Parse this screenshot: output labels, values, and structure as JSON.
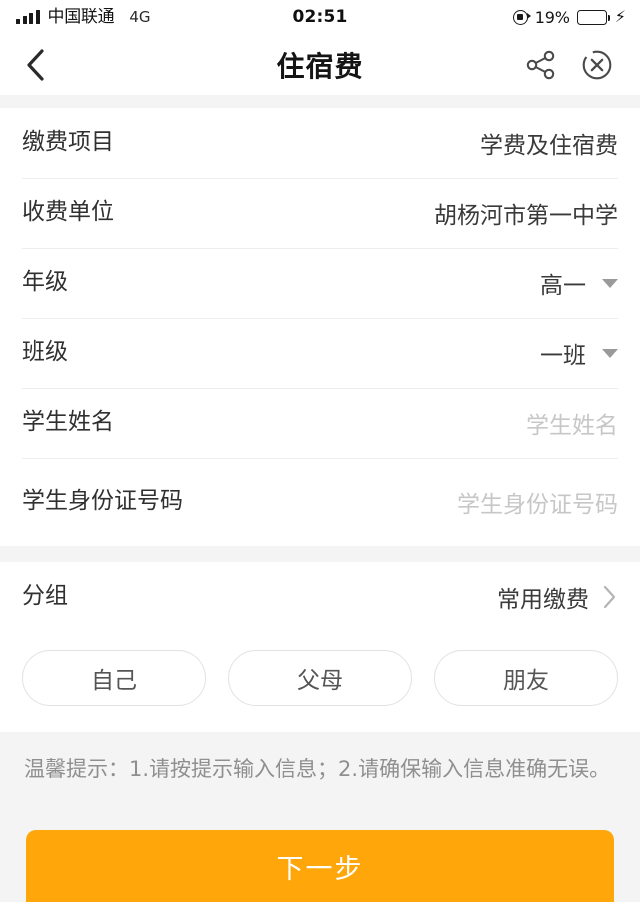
{
  "status_bar": {
    "carrier": "中国联通",
    "network_type": "4G",
    "time": "02:51",
    "battery_percent": "19%",
    "battery_level": 19,
    "battery_fill_color": "#ff7a00",
    "icons": [
      "signal-bars-icon",
      "rotation-lock-icon",
      "battery-icon",
      "charging-bolt-icon"
    ]
  },
  "nav": {
    "title": "住宿费",
    "back_icon": "back-chevron-icon",
    "share_icon": "share-icon",
    "close_icon": "close-circle-icon"
  },
  "form": {
    "rows": [
      {
        "label": "缴费项目",
        "value": "学费及住宿费",
        "kind": "text"
      },
      {
        "label": "收费单位",
        "value": "胡杨河市第一中学",
        "kind": "text"
      },
      {
        "label": "年级",
        "value": "高一",
        "kind": "select"
      },
      {
        "label": "班级",
        "value": "一班",
        "kind": "select"
      },
      {
        "label": "学生姓名",
        "value": "",
        "placeholder": "学生姓名",
        "kind": "input"
      },
      {
        "label": "学生身份证号码",
        "value": "",
        "placeholder": "学生身份证号码",
        "kind": "input"
      }
    ]
  },
  "group_section": {
    "label": "分组",
    "value": "常用缴费",
    "chevron_icon": "chevron-right-icon"
  },
  "relation_pills": [
    {
      "label": "自己"
    },
    {
      "label": "父母"
    },
    {
      "label": "朋友"
    }
  ],
  "tip": {
    "text": "温馨提示：1.请按提示输入信息；2.请确保输入信息准确无误。"
  },
  "cta": {
    "label": "下一步",
    "color": "#ffa60a"
  }
}
